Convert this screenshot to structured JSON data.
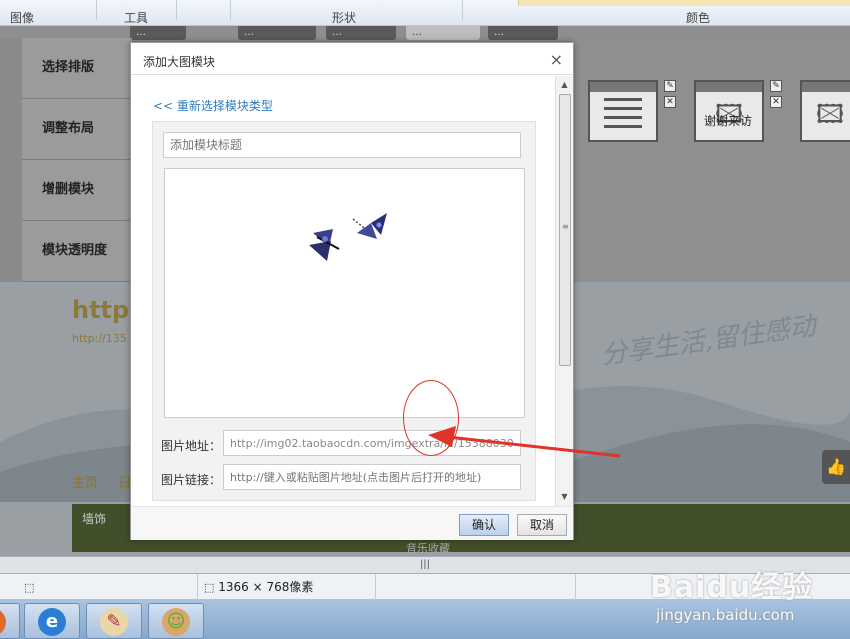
{
  "ribbon": {
    "groups": [
      "图像",
      "工具",
      "形状",
      "颜色"
    ]
  },
  "background": {
    "tabs": [
      "…",
      "…",
      "…",
      "…",
      "…"
    ],
    "side_menu": [
      "选择排版",
      "调整布局",
      "增删模块",
      "模块透明度"
    ],
    "thumb_caption": "谢谢来访",
    "url_big": "http:/",
    "url_small": "http://135",
    "nav": [
      "主页",
      "日"
    ],
    "green_label": "墙饰",
    "green_label2": "音乐收藏",
    "script_text": "分享生活,留住感动"
  },
  "dialog": {
    "title": "添加大图模块",
    "close": "×",
    "back_link": "<< 重新选择模块类型",
    "title_placeholder": "添加模块标题",
    "image_url_label": "图片地址：",
    "image_url_value": "http://img02.taobaocdn.com/imgextra/i2/15388030",
    "image_link_label": "图片链接：",
    "image_link_placeholder": "http://键入或粘贴图片地址(点击图片后打开的地址)",
    "ok_label": "确认",
    "cancel_label": "取消"
  },
  "splitter": {
    "grip": "|||"
  },
  "status": {
    "dimensions": "1366 × 768像素"
  },
  "taskbar": {
    "apps": [
      "ie-icon",
      "paint-icon",
      "users-icon"
    ]
  },
  "watermark": {
    "logo": "Baidu经验",
    "url": "jingyan.baidu.com"
  },
  "colors": {
    "accent_link": "#2f7cbd",
    "annotation": "#e0342a"
  }
}
